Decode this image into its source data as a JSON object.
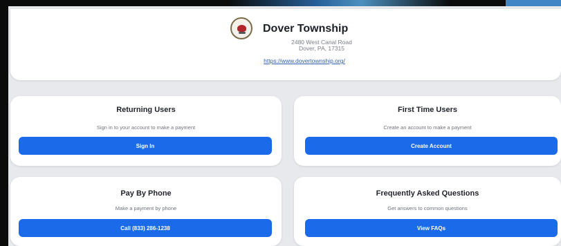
{
  "header": {
    "title": "Dover Township",
    "address_line1": "2480 West Canal Road",
    "address_line2": "Dover, PA, 17315",
    "website": "https://www.dovertownship.org/",
    "logo_icon": "township-seal-icon"
  },
  "cards": {
    "returning_users": {
      "title": "Returning Users",
      "description": "Sign in to your account to make a payment",
      "button": "Sign In"
    },
    "first_time_users": {
      "title": "First Time Users",
      "description": "Create an account to make a payment",
      "button": "Create Account"
    },
    "pay_by_phone": {
      "title": "Pay By Phone",
      "description": "Make a payment by phone",
      "button": "Call (833) 286-1238"
    },
    "faq": {
      "title": "Frequently Asked Questions",
      "description": "Get answers to common questions",
      "button": "View FAQs"
    }
  },
  "colors": {
    "primary_button": "#1a6aea",
    "link": "#2f5fb0",
    "background": "#e7e9ec"
  }
}
